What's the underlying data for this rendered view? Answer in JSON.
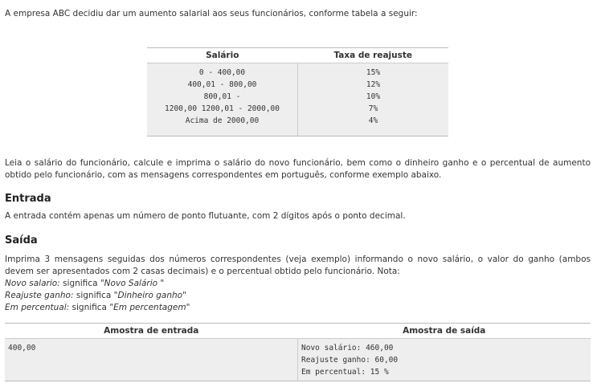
{
  "intro": "A empresa ABC decidiu dar um aumento salarial aos seus funcionários, conforme tabela a seguir:",
  "rate_table": {
    "headers": [
      "Salário",
      "Taxa de reajuste"
    ],
    "salaries": [
      "0 - 400,00",
      "400,01 - 800,00",
      "800,01 -",
      "1200,00 1200,01 - 2000,00",
      "Acima de 2000,00"
    ],
    "rates": [
      "15%",
      "12%",
      "10%",
      "7%",
      "4%"
    ]
  },
  "description": "Leia o salário do funcionário, calcule e imprima o salário do novo funcionário, bem como o dinheiro ganho e o percentual de aumento obtido pelo funcionário, com as mensagens correspondentes em português, conforme exemplo abaixo.",
  "entrada": {
    "title": "Entrada",
    "text": "A entrada contém apenas um número de ponto flutuante, com 2 dígitos após o ponto decimal."
  },
  "saida": {
    "title": "Saída",
    "text": "Imprima 3 mensagens seguidas dos números correspondentes (veja exemplo) informando o novo salário, o valor do ganho (ambos devem ser apresentados com 2 casas decimais) e o percentual obtido pelo funcionário. Nota:",
    "notes": [
      {
        "term": "Novo salario:",
        "connector": " significa ",
        "meaning": "\"Novo Salário \""
      },
      {
        "term": "Reajuste ganho:",
        "connector": " significa ",
        "meaning": "\"Dinheiro ganho\""
      },
      {
        "term": "Em percentual:",
        "connector": " significa ",
        "meaning": "\"Em percentagem\""
      }
    ]
  },
  "sample": {
    "headers": [
      "Amostra de entrada",
      "Amostra de saída"
    ],
    "input": "400,00",
    "output": [
      "Novo salário: 460,00",
      "Reajuste ganho: 60,00",
      "Em percentual: 15 %"
    ]
  }
}
